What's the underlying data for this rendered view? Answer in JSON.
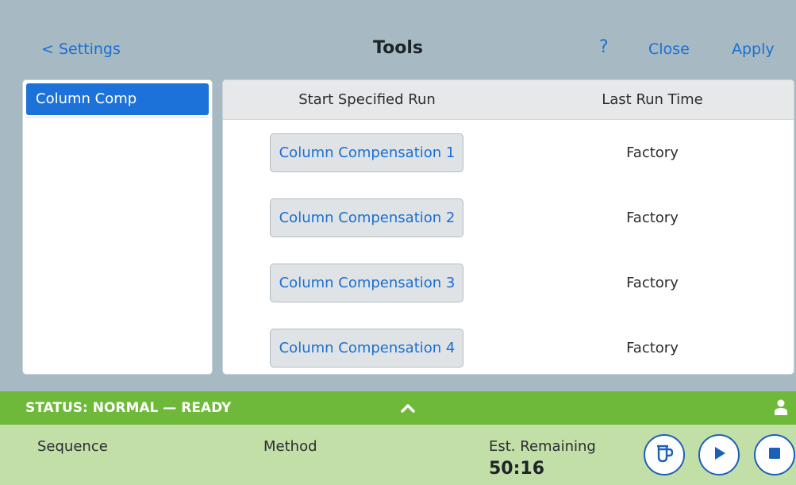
{
  "header": {
    "back_label": "< Settings",
    "title": "Tools",
    "help_label": "?",
    "close_label": "Close",
    "apply_label": "Apply"
  },
  "sidebar": {
    "items": [
      {
        "label": "Column Comp",
        "selected": true
      }
    ]
  },
  "table": {
    "columns": [
      "Start Specified Run",
      "Last Run Time"
    ],
    "rows": [
      {
        "run": "Column Compensation 1",
        "last_run": "Factory"
      },
      {
        "run": "Column Compensation 2",
        "last_run": "Factory"
      },
      {
        "run": "Column Compensation 3",
        "last_run": "Factory"
      },
      {
        "run": "Column Compensation 4",
        "last_run": "Factory"
      }
    ]
  },
  "status": {
    "text": "STATUS: NORMAL — READY",
    "expand_icon": "chevron-up-icon",
    "user_icon": "user-icon"
  },
  "info": {
    "sequence_label": "Sequence",
    "method_label": "Method",
    "est_remaining_label": "Est. Remaining",
    "est_remaining_value": "50:16"
  },
  "controls": {
    "vial_icon": "vial-icon",
    "play_icon": "play-icon",
    "stop_icon": "stop-icon"
  },
  "colors": {
    "accent": "#1a6fd1",
    "selected": "#1c72d8",
    "status_bar": "#6fb93a",
    "info_panel": "#c3dfa8",
    "background": "#a7bac4"
  }
}
